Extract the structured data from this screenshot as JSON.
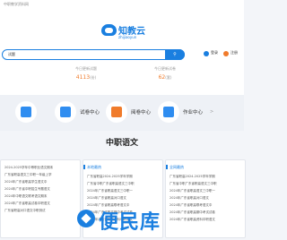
{
  "topbar": {
    "crumb": "中职教学资料网"
  },
  "logo": {
    "name": "知教云",
    "pinyin": "zhijiaoyun"
  },
  "search": {
    "value": "试题",
    "button": "搜索"
  },
  "user": {
    "login": "登录",
    "register": "注册"
  },
  "stats": [
    {
      "label": "今日更新试题",
      "value": "4113",
      "unit": "份"
    },
    {
      "label": "今日更新试卷",
      "value": "62",
      "unit": "套"
    }
  ],
  "categories": [
    {
      "label": "试卷中心",
      "color": "#2f8df0"
    },
    {
      "label": "阅卷中心",
      "color": "#f07b2b"
    },
    {
      "label": "作业中心",
      "color": "#2f8df0"
    }
  ],
  "section": {
    "title": "中职语文"
  },
  "cards": [
    {
      "title": "",
      "items": [
        "2024-2025学年中等职业语文期末",
        "广东省职高语文三中职一年级上学",
        "2024年广东省职高学生语文中",
        "2024年广东省中职招生专题语文",
        "2024年中职语文联考语文期末",
        "2024年广东省职高试卷中职语文",
        "广东省职高对口语文中职测试"
      ]
    },
    {
      "title": "本地最热",
      "items": [
        "广东省职高2024-2025学年学期",
        "广东省中职广东省职高语文三中职",
        "2024年广东省职高语文三中职一",
        "2024年广东省职高对口语文",
        "2024年广东省职高联考语文中",
        "2024年广东省职高期中考试试卷",
        "2024年广东省职高资料中职语文"
      ]
    },
    {
      "title": "全网最热",
      "items": [
        "广东省职高2024-2025学年学期",
        "广东省中职广东省职高语文三中职",
        "2024年广东省职高语文三中职一",
        "2024年广东省职高对口语文",
        "2024年广东省职高联考语文中",
        "2024年广东省职高期中考试试卷",
        "2024年广东省职高资料中职语文"
      ]
    }
  ],
  "watermark": {
    "text": "便民库"
  }
}
